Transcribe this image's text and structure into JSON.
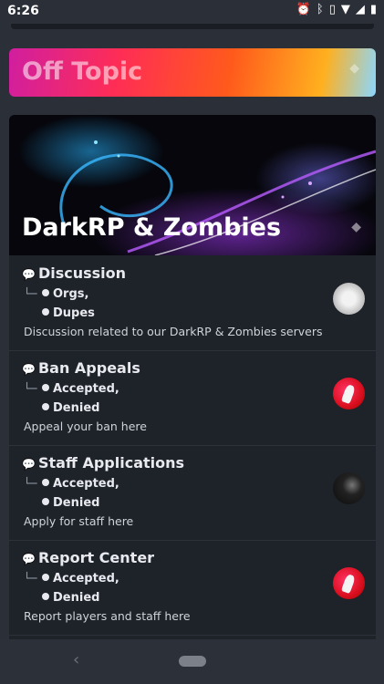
{
  "status_bar": {
    "time": "6:26",
    "icons": [
      "alarm-icon",
      "bluetooth-icon",
      "vibrate-icon",
      "wifi-icon",
      "signal-icon",
      "battery-icon"
    ]
  },
  "categories": [
    {
      "title": "Off Topic"
    },
    {
      "title": "DarkRP & Zombies"
    }
  ],
  "forums": [
    {
      "name": "Discussion",
      "subforums": [
        "Orgs,",
        "Dupes"
      ],
      "description": "Discussion related to our DarkRP & Zombies servers",
      "avatar_color": "#e0e0e0"
    },
    {
      "name": "Ban Appeals",
      "subforums": [
        "Accepted,",
        "Denied"
      ],
      "description": "Appeal your ban here",
      "avatar_color": "#d41f2e"
    },
    {
      "name": "Staff Applications",
      "subforums": [
        "Accepted,",
        "Denied"
      ],
      "description": "Apply for staff here",
      "avatar_color": "#111111"
    },
    {
      "name": "Report Center",
      "subforums": [
        "Accepted,",
        "Denied"
      ],
      "description": "Report players and staff here",
      "avatar_color": "#d41f2e"
    }
  ],
  "tree_connector": "└─"
}
